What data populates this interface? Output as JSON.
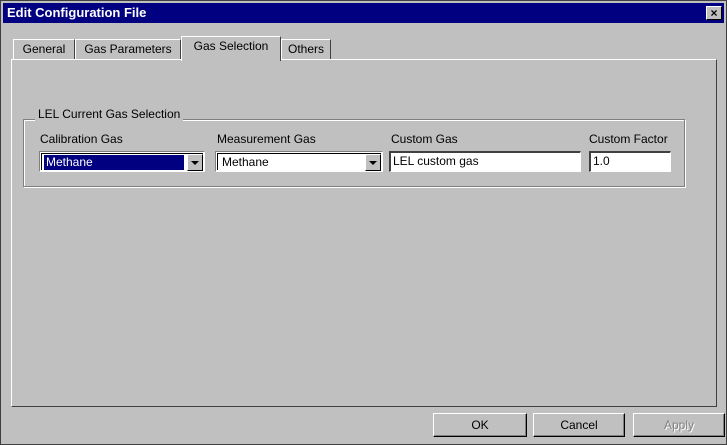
{
  "window": {
    "title": "Edit Configuration File",
    "close_glyph": "×"
  },
  "tabs": [
    {
      "label": "General",
      "active": false
    },
    {
      "label": "Gas Parameters",
      "active": false
    },
    {
      "label": "Gas Selection",
      "active": true
    },
    {
      "label": "Others",
      "active": false
    }
  ],
  "group": {
    "title": "LEL Current Gas Selection",
    "calibration_gas": {
      "label": "Calibration Gas",
      "value": "Methane"
    },
    "measurement_gas": {
      "label": "Measurement Gas",
      "value": "Methane"
    },
    "custom_gas": {
      "label": "Custom Gas",
      "value": "LEL custom gas"
    },
    "custom_factor": {
      "label": "Custom Factor",
      "value": "1.0"
    }
  },
  "buttons": {
    "ok": "OK",
    "cancel": "Cancel",
    "apply": "Apply"
  },
  "colors": {
    "titlebar": "#000080",
    "face": "#c0c0c0",
    "selection": "#000080"
  }
}
